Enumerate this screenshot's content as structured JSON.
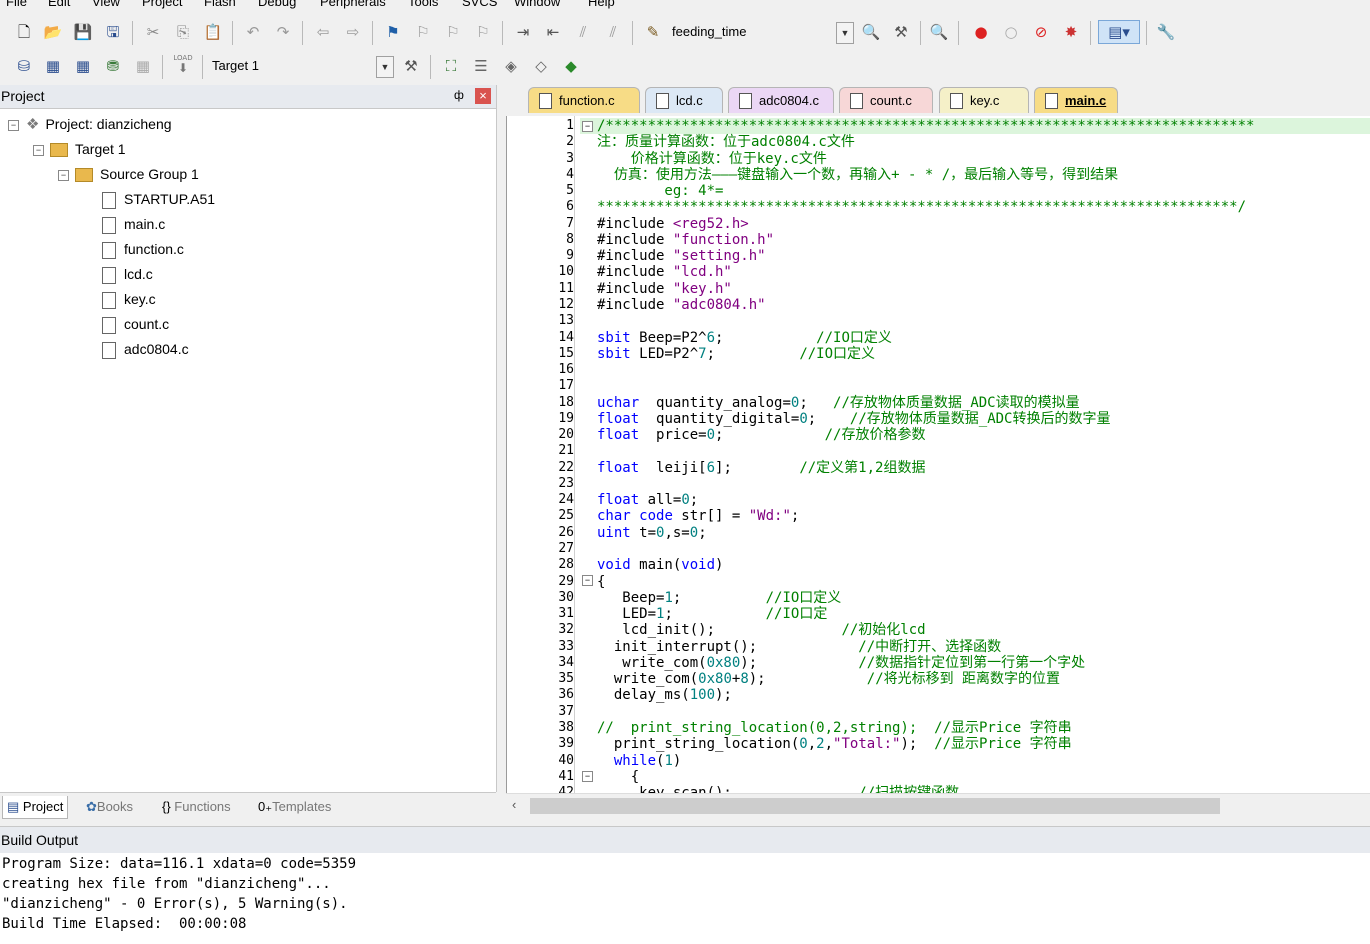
{
  "menu": [
    "File",
    "Edit",
    "View",
    "Project",
    "Flash",
    "Debug",
    "Peripherals",
    "Tools",
    "SVCS",
    "Window",
    "Help"
  ],
  "toolbar": {
    "target_function": "feeding_time",
    "target_name": "Target 1",
    "load_label": "LOAD"
  },
  "project_panel": {
    "title": "Project",
    "pin": "ф",
    "close": "×",
    "root": "Project: dianzicheng",
    "target": "Target 1",
    "group": "Source Group 1",
    "files": [
      "STARTUP.A51",
      "main.c",
      "function.c",
      "lcd.c",
      "key.c",
      "count.c",
      "adc0804.c"
    ],
    "tabs": [
      "Project",
      "Books",
      "Functions",
      "Templates"
    ]
  },
  "editor": {
    "tabs": [
      "function.c",
      "lcd.c",
      "adc0804.c",
      "count.c",
      "key.c",
      "main.c"
    ],
    "active_tab": "main.c",
    "line_numbers": [
      "1",
      "2",
      "3",
      "4",
      "5",
      "6",
      "7",
      "8",
      "9",
      "10",
      "11",
      "12",
      "13",
      "14",
      "15",
      "16",
      "17",
      "18",
      "19",
      "20",
      "21",
      "22",
      "23",
      "24",
      "25",
      "26",
      "27",
      "28",
      "29",
      "30",
      "31",
      "32",
      "33",
      "34",
      "35",
      "36",
      "37",
      "38",
      "39",
      "40",
      "41",
      "42"
    ],
    "lines": [
      "/*****************************************************************************",
      "注：质量计算函数：位于adc0804.c文件",
      "    价格计算函数：位于key.c文件",
      "  仿真：使用方法———键盘输入一个数，再输入+ - * /，最后输入等号，得到结果",
      "        eg: 4*=",
      "****************************************************************************/",
      "#include <reg52.h>",
      "#include \"function.h\"",
      "#include \"setting.h\"",
      "#include \"lcd.h\"",
      "#include \"key.h\"",
      "#include \"adc0804.h\"",
      "",
      "sbit Beep=P2^6;           //IO口定义",
      "sbit LED=P2^7;          //IO口定义",
      "",
      "",
      "uchar  quantity_analog=0;   //存放物体质量数据_ADC读取的模拟量",
      "float  quantity_digital=0;    //存放物体质量数据_ADC转换后的数字量",
      "float  price=0;            //存放价格参数",
      "",
      "float  leiji[6];        //定义第1,2组数据",
      "",
      "float all=0;",
      "char code str[] = \"Wd:\";",
      "uint t=0,s=0;",
      "",
      "void main(void)",
      "{",
      "   Beep=1;          //IO口定义",
      "   LED=1;           //IO口定",
      "   lcd_init();               //初始化lcd",
      "  init_interrupt();            //中断打开、选择函数",
      "   write_com(0x80);            //数据指针定位到第一行第一个字处",
      "  write_com(0x80+8);            //将光标移到 距离数字的位置",
      "  delay_ms(100);",
      "",
      "//  print_string_location(0,2,string);  //显示Price 字符串",
      "  print_string_location(0,2,\"Total:\");  //显示Price 字符串",
      "  while(1)",
      "    {",
      "     key_scan();               //扫描按键函数"
    ]
  },
  "build_output": {
    "title": "Build Output",
    "lines": [
      "Program Size: data=116.1 xdata=0 code=5359",
      "creating hex file from \"dianzicheng\"...",
      "\"dianzicheng\" - 0 Error(s), 5 Warning(s).",
      "Build Time Elapsed:  00:00:08"
    ]
  },
  "icons": [
    "new-file-icon",
    "open-icon",
    "save-icon",
    "save-all-icon",
    "cut-icon",
    "copy-icon",
    "paste-icon",
    "undo-icon",
    "redo-icon",
    "back-icon",
    "forward-icon",
    "bookmark-icon",
    "indent-icon",
    "outdent-icon",
    "find-icon",
    "debug-icon",
    "breakpoint-icon",
    "build-icon",
    "rebuild-icon",
    "target-options-icon",
    "wrench-icon"
  ],
  "colors": {
    "keyword": "#0000ff",
    "comment": "#008000",
    "string": "#800080",
    "number": "#008080",
    "active_tab": "#f7dc86",
    "tab": "#ebd7f5"
  }
}
